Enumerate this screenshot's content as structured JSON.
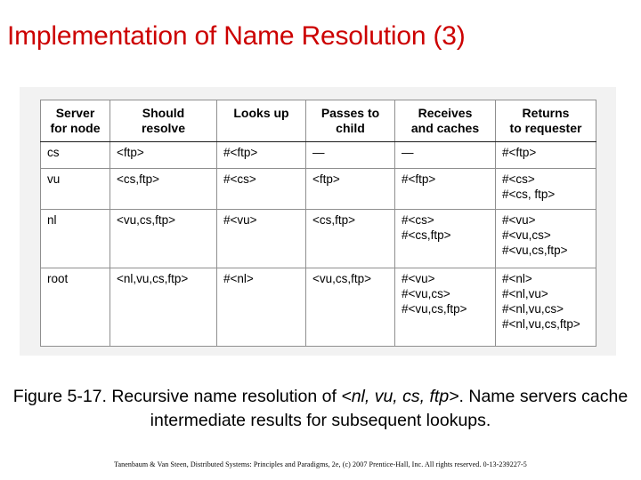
{
  "slide": {
    "title": "Implementation of Name Resolution (3)",
    "title_color": "#CC0000",
    "background": "#FFFFFF",
    "panel_background": "#F2F2F2"
  },
  "table": {
    "headers": [
      "Server for node",
      "Should resolve",
      "Looks up",
      "Passes to child",
      "Receives and caches",
      "Returns to requester"
    ],
    "headers_lines": [
      [
        "Server",
        "for node"
      ],
      [
        "Should",
        "resolve"
      ],
      [
        "Looks up",
        ""
      ],
      [
        "Passes to",
        "child"
      ],
      [
        "Receives",
        "and caches"
      ],
      [
        "Returns",
        "to requester"
      ]
    ],
    "rows": [
      {
        "server": "cs",
        "should_resolve": "<ftp>",
        "looks_up": "#<ftp>",
        "passes_to_child": "—",
        "receives_and_caches": [
          "—"
        ],
        "returns_to_requester": [
          "#<ftp>"
        ]
      },
      {
        "server": "vu",
        "should_resolve": "<cs,ftp>",
        "looks_up": "#<cs>",
        "passes_to_child": "<ftp>",
        "receives_and_caches": [
          "#<ftp>"
        ],
        "returns_to_requester": [
          "#<cs>",
          "#<cs, ftp>"
        ]
      },
      {
        "server": "nl",
        "should_resolve": "<vu,cs,ftp>",
        "looks_up": "#<vu>",
        "passes_to_child": "<cs,ftp>",
        "receives_and_caches": [
          "#<cs>",
          "#<cs,ftp>"
        ],
        "returns_to_requester": [
          "#<vu>",
          "#<vu,cs>",
          "#<vu,cs,ftp>"
        ]
      },
      {
        "server": "root",
        "should_resolve": "<nl,vu,cs,ftp>",
        "looks_up": "#<nl>",
        "passes_to_child": "<vu,cs,ftp>",
        "receives_and_caches": [
          "#<vu>",
          "#<vu,cs>",
          "#<vu,cs,ftp>"
        ],
        "returns_to_requester": [
          "#<nl>",
          "#<nl,vu>",
          "#<nl,vu,cs>",
          "#<nl,vu,cs,ftp>"
        ]
      }
    ]
  },
  "caption": {
    "prefix": "Figure 5-17. Recursive name resolution of ",
    "emphasis": "<nl, vu, cs, ftp>",
    "suffix": ". Name servers cache intermediate results for subsequent lookups."
  },
  "footer": {
    "text": "Tanenbaum & Van Steen, Distributed Systems: Principles and Paradigms, 2e, (c) 2007 Prentice-Hall, Inc. All rights reserved. 0-13-239227-5"
  }
}
